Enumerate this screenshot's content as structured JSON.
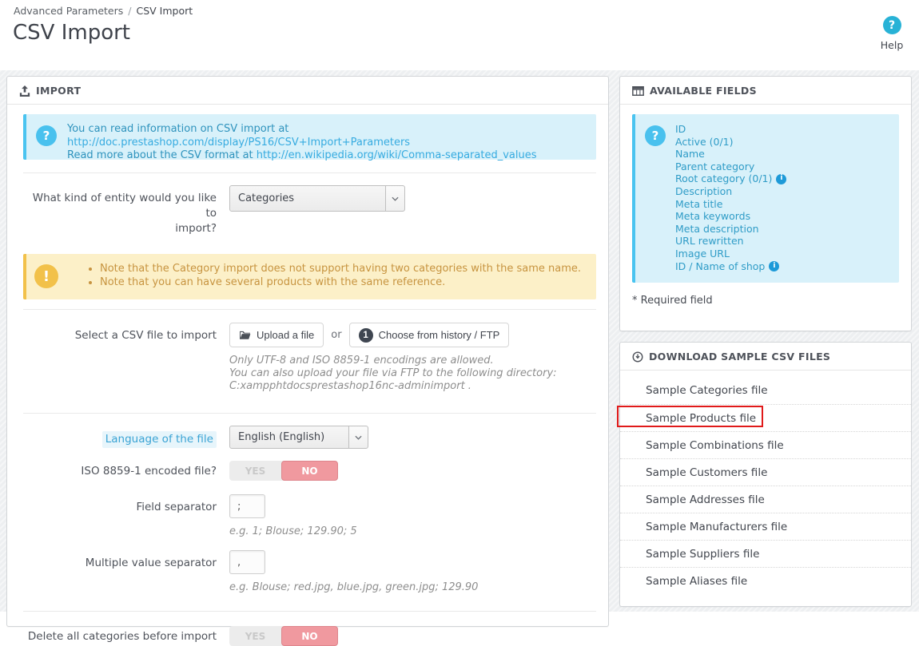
{
  "page": {
    "breadcrumb": {
      "section": "Advanced Parameters",
      "separator": "/",
      "current": "CSV Import"
    },
    "title": "CSV Import",
    "help_label": "Help"
  },
  "icons": {
    "question_glyph": "?",
    "warning_glyph": "!",
    "info_glyph": "i"
  },
  "import_panel": {
    "title": "IMPORT",
    "info_alert": {
      "line1_text": "You can read information on CSV import at ",
      "line1_link": "http://doc.prestashop.com/display/PS16/CSV+Import+Parameters",
      "line2_text": "Read more about the CSV format at ",
      "line2_link": "http://en.wikipedia.org/wiki/Comma-separated_values"
    },
    "entity_row": {
      "label_line1": "What kind of entity would you like to",
      "label_line2": "import?",
      "value": "Categories"
    },
    "warning_alert": {
      "bullet1": "Note that the Category import does not support having two categories with the same name.",
      "bullet2": "Note that you can have several products with the same reference."
    },
    "file_row": {
      "label": "Select a CSV file to import",
      "upload_button": "Upload a file",
      "or": "or",
      "history_badge": "1",
      "history_button": "Choose from history / FTP",
      "help_line1": "Only UTF-8 and ISO 8859-1 encodings are allowed.",
      "help_line2": "You can also upload your file via FTP to the following directory:",
      "help_line3": "C:xampphtdocsprestashop16nc-adminimport ."
    },
    "language_row": {
      "label": "Language of the file",
      "value": "English (English)"
    },
    "iso_row": {
      "label": "ISO 8859-1 encoded file?",
      "yes": "YES",
      "no": "NO"
    },
    "field_separator_row": {
      "label": "Field separator",
      "value": ";",
      "example": "e.g. 1; Blouse; 129.90; 5"
    },
    "multiple_separator_row": {
      "label": "Multiple value separator",
      "value": ",",
      "example": "e.g. Blouse; red.jpg, blue.jpg, green.jpg; 129.90"
    },
    "delete_row": {
      "label": "Delete all categories before import",
      "yes": "YES",
      "no": "NO"
    }
  },
  "available_fields_panel": {
    "title": "AVAILABLE FIELDS",
    "fields": [
      {
        "label": "ID"
      },
      {
        "label": "Active (0/1)"
      },
      {
        "label": "Name"
      },
      {
        "label": "Parent category"
      },
      {
        "label": "Root category (0/1)",
        "has_info": true
      },
      {
        "label": "Description"
      },
      {
        "label": "Meta title"
      },
      {
        "label": "Meta keywords"
      },
      {
        "label": "Meta description"
      },
      {
        "label": "URL rewritten"
      },
      {
        "label": "Image URL"
      },
      {
        "label": "ID / Name of shop",
        "has_info": true
      }
    ],
    "required_note": "* Required field"
  },
  "samples_panel": {
    "title": "DOWNLOAD SAMPLE CSV FILES",
    "items": [
      "Sample Categories file",
      "Sample Products file",
      "Sample Combinations file",
      "Sample Customers file",
      "Sample Addresses file",
      "Sample Manufacturers file",
      "Sample Suppliers file",
      "Sample Aliases file"
    ],
    "highlighted_item": "Sample Products file"
  },
  "colors": {
    "accent_teal": "#28b2d6",
    "link_blue": "#36abe0",
    "info_alert_bg": "#d8f1fa",
    "info_alert_border": "#4ac4f0",
    "warning_bg": "#fcf0c8",
    "warning_border": "#f2c14a",
    "switch_no_bg": "#f0999f",
    "annotation_red": "#e01a1a"
  }
}
